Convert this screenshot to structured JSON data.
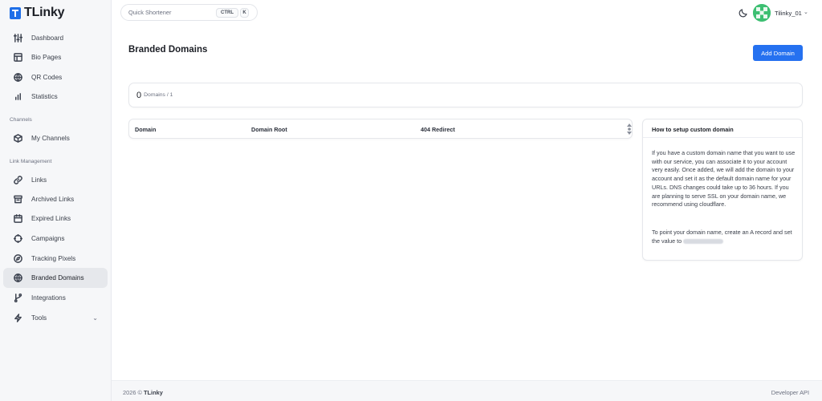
{
  "app": {
    "name": "TLinky",
    "brand_color": "#1f6fe8",
    "accent_color": "#2571f0"
  },
  "sidebar": {
    "main_items": [
      {
        "label": "Dashboard",
        "icon": "sliders-icon"
      },
      {
        "label": "Bio Pages",
        "icon": "layout-icon"
      },
      {
        "label": "QR Codes",
        "icon": "qr-icon"
      },
      {
        "label": "Statistics",
        "icon": "bar-chart-icon"
      }
    ],
    "channels_section": "Channels",
    "channels_items": [
      {
        "label": "My Channels",
        "icon": "box-icon"
      }
    ],
    "link_section": "Link Management",
    "link_items": [
      {
        "label": "Links",
        "icon": "link-icon"
      },
      {
        "label": "Archived Links",
        "icon": "archive-icon"
      },
      {
        "label": "Expired Links",
        "icon": "calendar-icon"
      },
      {
        "label": "Campaigns",
        "icon": "target-icon"
      },
      {
        "label": "Tracking Pixels",
        "icon": "compass-icon"
      },
      {
        "label": "Branded Domains",
        "icon": "globe-icon",
        "active": true
      },
      {
        "label": "Integrations",
        "icon": "git-branch-icon"
      },
      {
        "label": "Tools",
        "icon": "zap-icon",
        "has_chevron": true
      }
    ]
  },
  "topbar": {
    "search_placeholder": "Quick Shortener",
    "shortcut_ctrl": "CTRL",
    "shortcut_k": "K",
    "username": "Tilinky_01"
  },
  "page": {
    "title": "Branded Domains",
    "add_button": "Add Domain",
    "count": "0",
    "count_label": "Domains / 1"
  },
  "table": {
    "columns": [
      "Domain",
      "Domain Root",
      "404 Redirect"
    ]
  },
  "help": {
    "title": "How to setup custom domain",
    "paragraph1": "If you have a custom domain name that you want to use with our service, you can associate it to your account very easily. Once added, we will add the domain to your account and set it as the default domain name for your URLs. DNS changes could take up to 36 hours. If you are planning to serve SSL on your domain name, we recommend using cloudflare.",
    "paragraph2": "To point your domain name, create an A record and set the value to"
  },
  "footer": {
    "year": "2026 ©",
    "brand": "TLinky",
    "developer_api": "Developer API"
  }
}
